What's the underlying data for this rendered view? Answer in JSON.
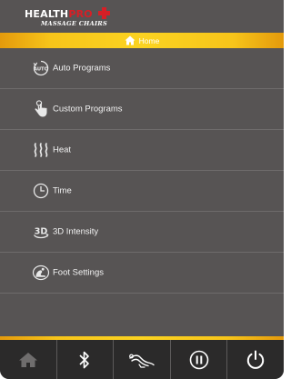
{
  "brand": {
    "name_white": "HEALTH",
    "name_red": "PRO",
    "tagline": "MASSAGE CHAIRS"
  },
  "home_bar": {
    "label": "Home",
    "icon": "home-icon"
  },
  "menu": {
    "items": [
      {
        "label": "Auto Programs",
        "icon": "auto-icon"
      },
      {
        "label": "Custom Programs",
        "icon": "touch-hand-icon"
      },
      {
        "label": "Heat",
        "icon": "heat-waves-icon"
      },
      {
        "label": "Time",
        "icon": "clock-icon"
      },
      {
        "label": "3D Intensity",
        "icon": "3d-icon"
      },
      {
        "label": "Foot Settings",
        "icon": "foot-icon"
      }
    ]
  },
  "toolbar": {
    "items": [
      {
        "icon": "home-icon",
        "active": false
      },
      {
        "icon": "bluetooth-icon"
      },
      {
        "icon": "massage-chair-icon"
      },
      {
        "icon": "pause-icon"
      },
      {
        "icon": "power-icon"
      }
    ]
  },
  "colors": {
    "background": "#575454",
    "accent_gold": "#fbd321",
    "accent_orange": "#e49a0c",
    "brand_red": "#d61f26",
    "toolbar": "#2b2a2a",
    "disabled_icon": "#6f6d6d"
  }
}
